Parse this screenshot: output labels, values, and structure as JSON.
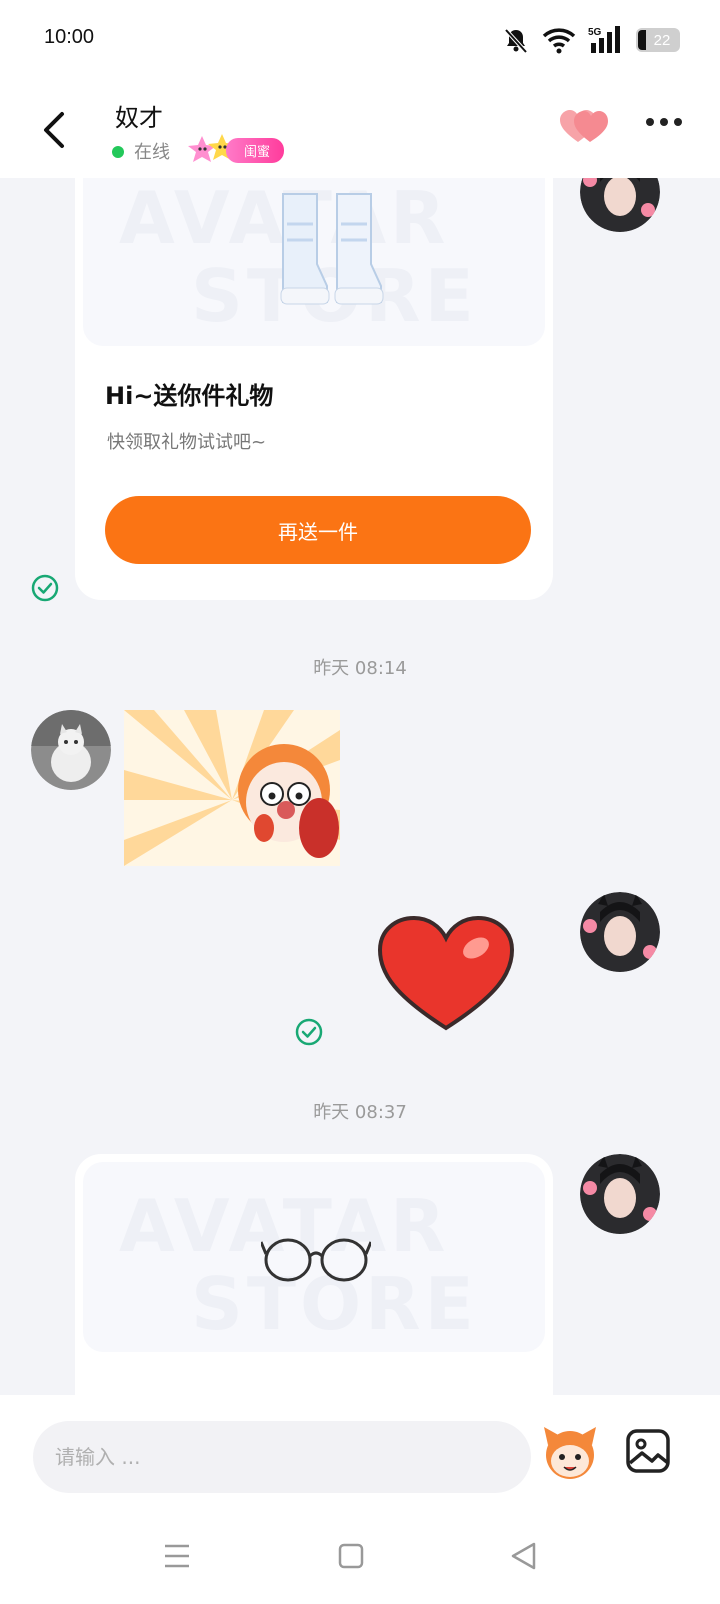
{
  "status": {
    "time": "10:00",
    "battery": "22",
    "network": "5G"
  },
  "header": {
    "name": "奴才",
    "online": "在线",
    "badge": "闺蜜"
  },
  "messages": {
    "gift1": {
      "title": "Hi~送你件礼物",
      "subtitle": "快领取礼物试试吧~",
      "button": "再送一件",
      "watermark_1": "AVATAR",
      "watermark_2": "STORE"
    },
    "time1": "昨天 08:14",
    "time2": "昨天 08:37",
    "gift2": {
      "watermark_1": "AVATAR",
      "watermark_2": "STORE"
    }
  },
  "input": {
    "placeholder": "请输入 ..."
  },
  "colors": {
    "accent": "#fb7414",
    "online": "#23c85a",
    "check": "#18a874",
    "badge": "#ff3c9c"
  }
}
